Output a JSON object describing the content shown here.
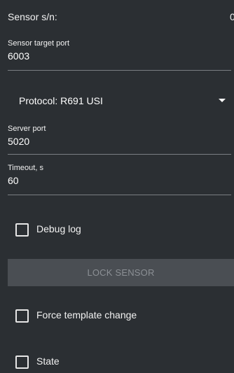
{
  "sensor": {
    "serial_label": "Sensor s/n:",
    "serial_value": "0"
  },
  "fields": {
    "target_port": {
      "label": "Sensor target port",
      "value": "6003"
    },
    "server_port": {
      "label": "Server port",
      "value": "5020"
    },
    "timeout": {
      "label": "Timeout, s",
      "value": "60"
    }
  },
  "protocol": {
    "selected_label": "Protocol: R691 USI"
  },
  "checkboxes": {
    "debug_log": {
      "label": "Debug log",
      "checked": false
    },
    "force_template_change": {
      "label": "Force template change",
      "checked": false
    },
    "state": {
      "label": "State",
      "checked": false
    }
  },
  "buttons": {
    "lock_sensor": {
      "label": "LOCK SENSOR",
      "enabled": false
    }
  },
  "colors": {
    "background": "#2b2f33",
    "underline": "#7a7e83",
    "disabled_button_bg": "#4a4e53",
    "disabled_button_text": "#8c9095"
  }
}
